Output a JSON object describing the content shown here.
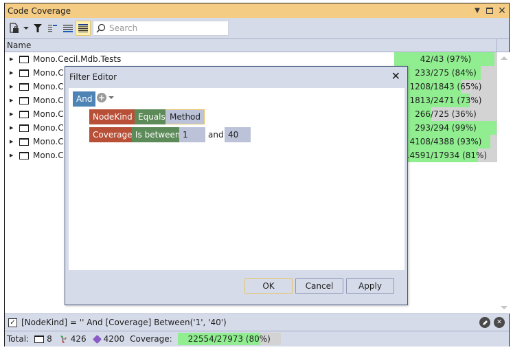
{
  "window": {
    "title": "Code Coverage",
    "controls": [
      {
        "name": "dropdown",
        "glyph": "▾"
      },
      {
        "name": "maximize",
        "glyph": "□"
      },
      {
        "name": "close",
        "glyph": "✕"
      }
    ]
  },
  "toolbar": {
    "search_placeholder": "Search",
    "search_value": ""
  },
  "columns": {
    "name_header": "Name"
  },
  "rows": [
    {
      "name": "Mono.Cecil.Mdb.Tests",
      "coverage": "42/43 (97%)",
      "percent": 97
    },
    {
      "name": "Mono.C",
      "coverage": "233/275 (84%)",
      "percent": 84
    },
    {
      "name": "Mono.C",
      "coverage": "1208/1843 (65%)",
      "percent": 65
    },
    {
      "name": "Mono.C",
      "coverage": "1813/2471 (73%)",
      "percent": 73
    },
    {
      "name": "Mono.C",
      "coverage": "266/725 (36%)",
      "percent": 36
    },
    {
      "name": "Mono.C",
      "coverage": "293/294 (99%)",
      "percent": 99
    },
    {
      "name": "Mono.C",
      "coverage": "4108/4388 (93%)",
      "percent": 93
    },
    {
      "name": "Mono.C",
      "coverage": "14591/17934 (81%)",
      "percent": 81
    }
  ],
  "filter_bar": {
    "enabled": true,
    "check_glyph": "✓",
    "expression": "[NodeKind] = '' And [Coverage] Between('1', '40')"
  },
  "status": {
    "total_label": "Total:",
    "projects": "8",
    "namespaces": "426",
    "types": "4200",
    "coverage_label": "Coverage:",
    "coverage": "22554/27973 (80%)",
    "coverage_percent": 80
  },
  "dialog": {
    "title": "Filter Editor",
    "group_operator": "And",
    "conditions": [
      {
        "field": "NodeKind",
        "operator": "Equals",
        "value": "Method"
      },
      {
        "field": "Coverage",
        "operator": "Is between",
        "value1": "1",
        "joiner": "and",
        "value2": "40"
      }
    ],
    "buttons": {
      "ok": "OK",
      "cancel": "Cancel",
      "apply": "Apply"
    }
  },
  "colors": {
    "title_bar": "#f5cc84",
    "panel": "#d6dbe9",
    "coverage_fill": "#90ee90",
    "coverage_track": "#d3d3d3",
    "group_chip": "#4e84b5",
    "field_chip": "#b84f37",
    "operator_chip": "#5c8a58",
    "value_chip": "#bcc3d9"
  }
}
